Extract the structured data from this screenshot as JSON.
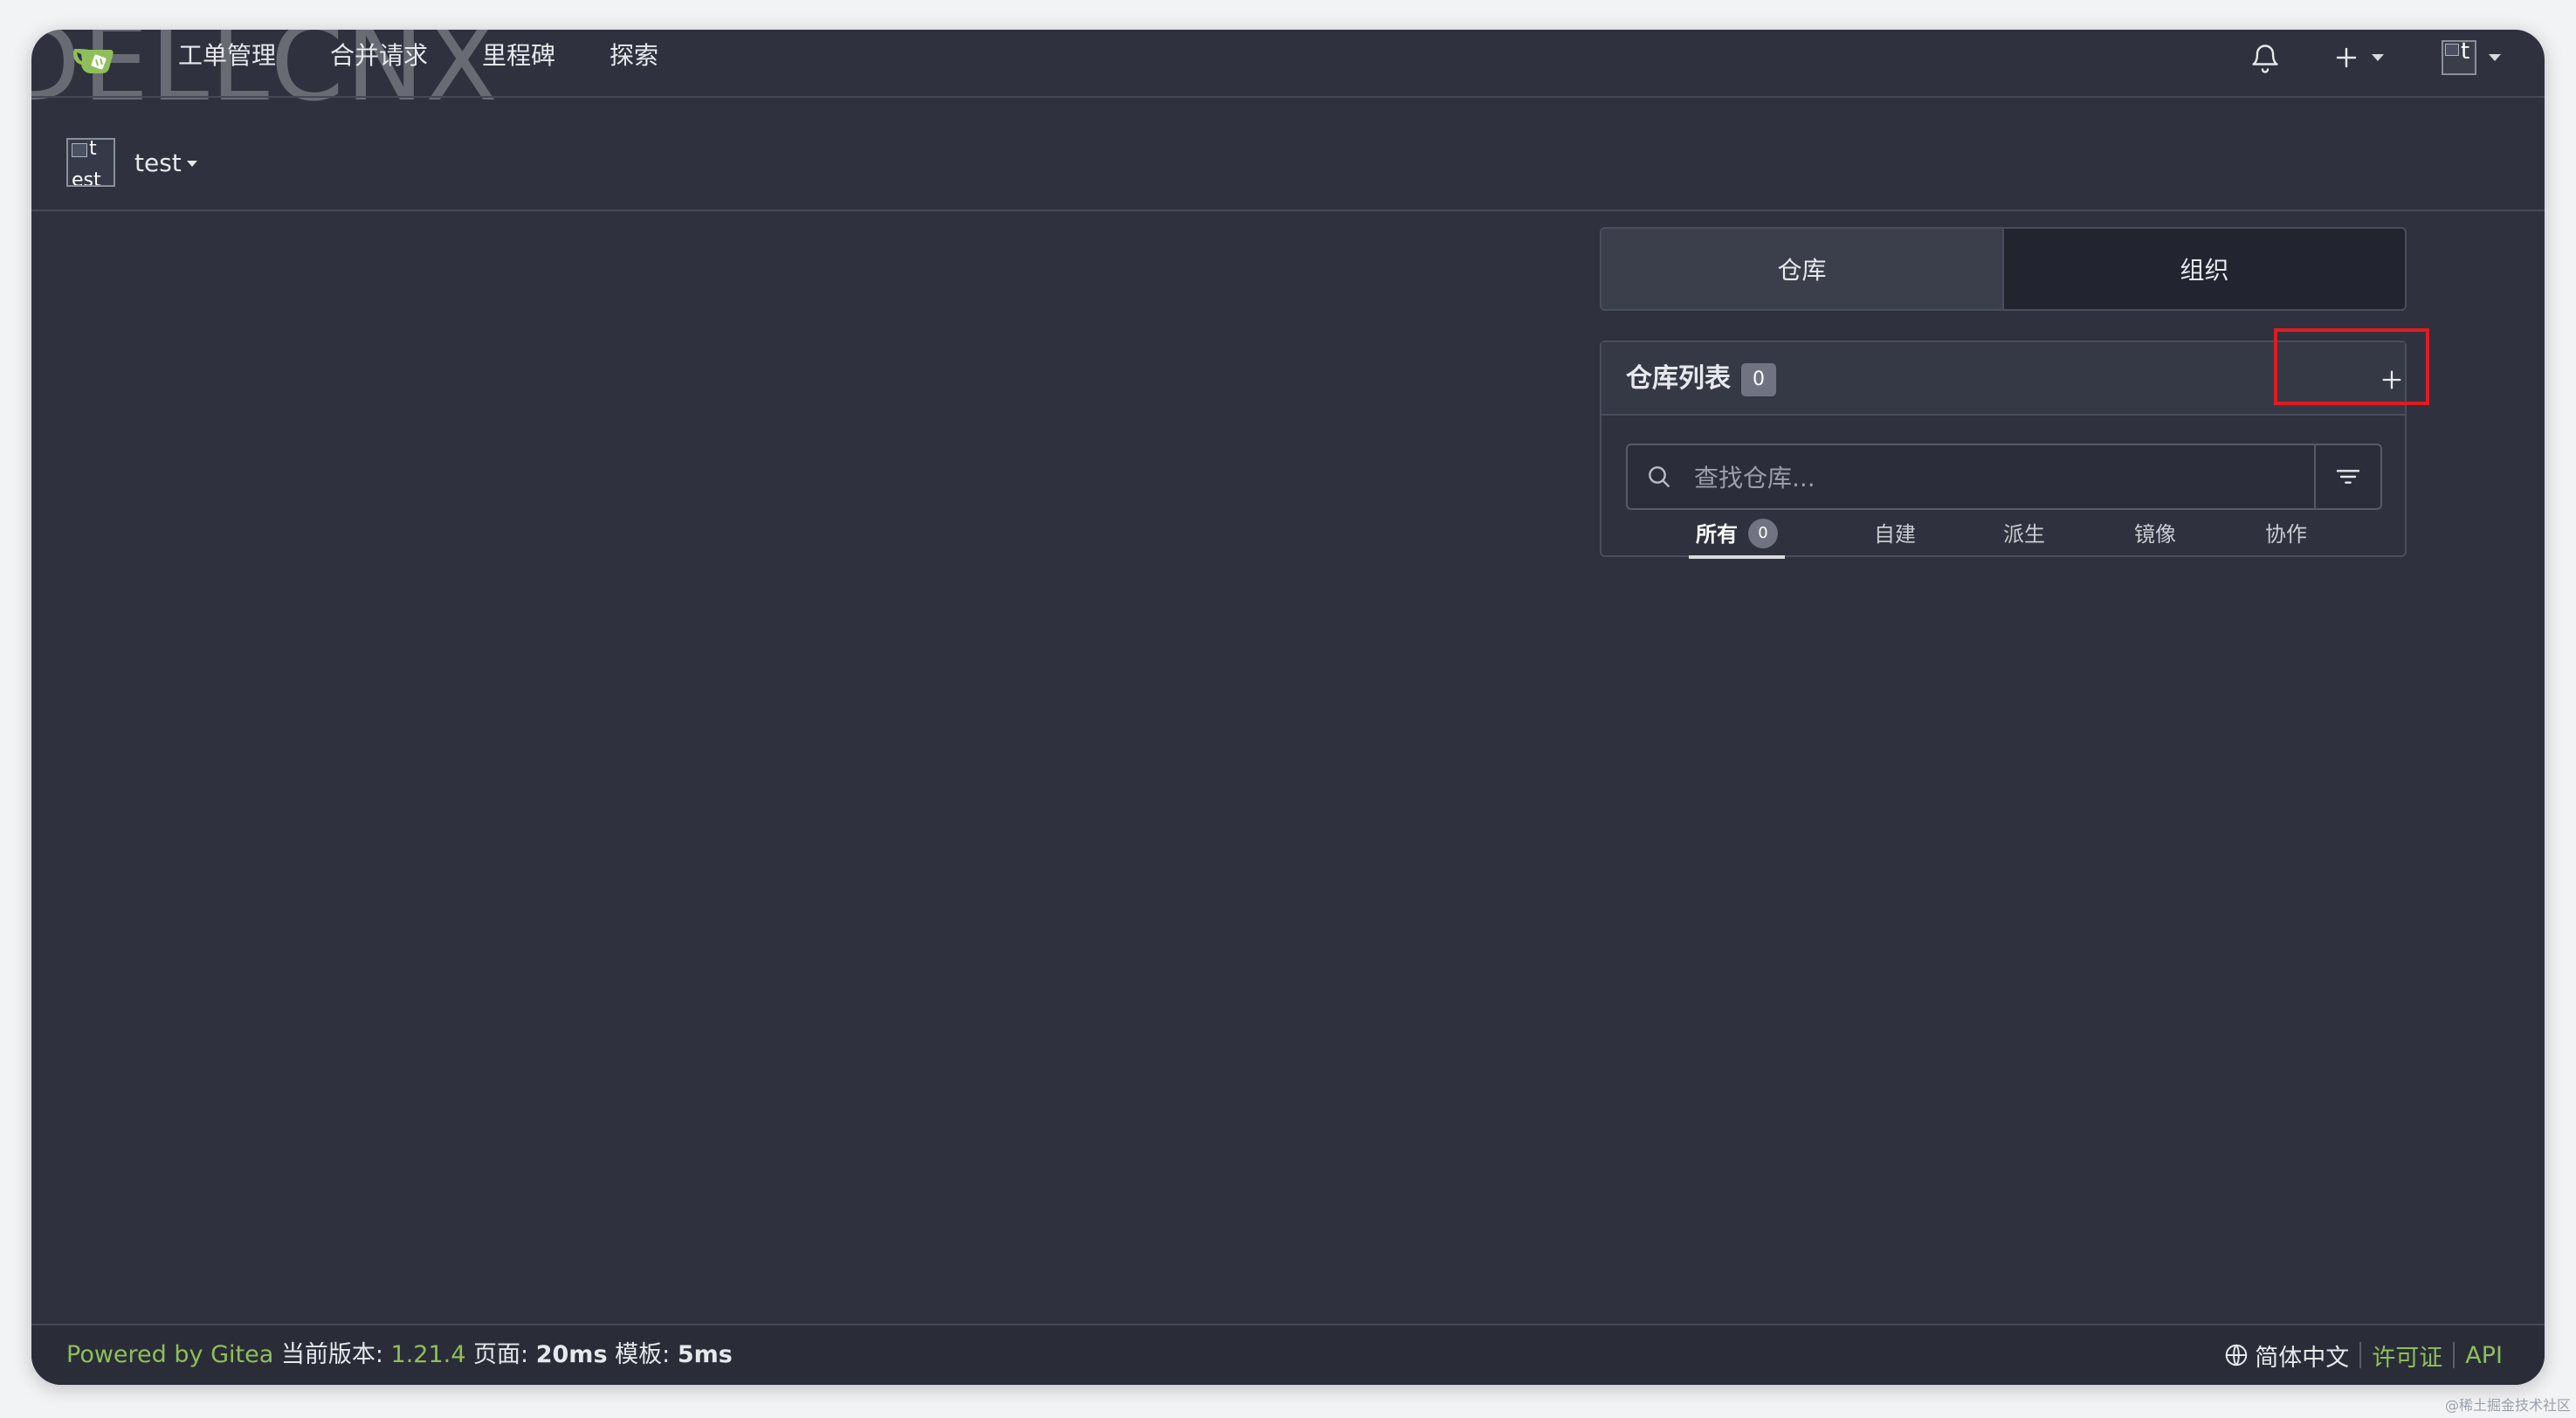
{
  "navbar": {
    "items": [
      "工单管理",
      "合并请求",
      "里程碑",
      "探索"
    ],
    "avatar_text": "t"
  },
  "watermark": "DELLCNX",
  "context": {
    "name": "test",
    "avatar_text_1": "t",
    "avatar_text_2": "est"
  },
  "tabs": {
    "repos": "仓库",
    "orgs": "组织"
  },
  "repo_list": {
    "title": "仓库列表",
    "count": "0",
    "search_placeholder": "查找仓库...",
    "filters": {
      "all": "所有",
      "all_count": "0",
      "sources": "自建",
      "forks": "派生",
      "mirrors": "镜像",
      "collaborative": "协作"
    }
  },
  "footer": {
    "powered_by": "Powered by Gitea",
    "version_label": "当前版本:",
    "version": "1.21.4",
    "page_label": "页面:",
    "page_time": "20ms",
    "template_label": "模板:",
    "template_time": "5ms",
    "language": "简体中文",
    "license": "许可证",
    "api": "API"
  },
  "credit": "@稀土掘金技术社区",
  "colors": {
    "background": "#2f323e",
    "accent_green": "#8fbf5a",
    "highlight_red": "#e11b22"
  }
}
